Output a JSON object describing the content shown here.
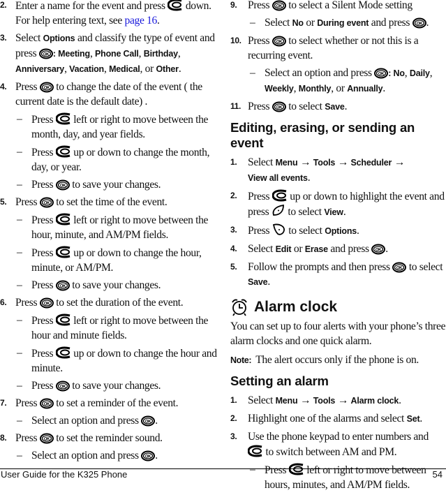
{
  "left": {
    "s2": {
      "num": "2.",
      "t1": "Enter a name for the event and press ",
      "t2": " down. For help entering text, see ",
      "link": "page 16",
      "t3": "."
    },
    "s3": {
      "num": "3.",
      "t1": "Select ",
      "ui1": "Options",
      "t2": " and classify the type of event and press ",
      "t3": ": ",
      "opts": [
        "Meeting",
        "Phone Call",
        "Birthday",
        "Anniversary",
        "Vacation",
        "Medical"
      ],
      "or": ", or ",
      "last": "Other",
      "end": "."
    },
    "s4": {
      "num": "4.",
      "t1": "Press ",
      "t2": " to change the date of the event ( the current date is the default date) .",
      "subs": [
        {
          "t1": "Press ",
          "t2": " left or right to move between the month, day, and year fields."
        },
        {
          "t1": "Press ",
          "t2": " up or down to change the month, day, or year."
        },
        {
          "t1": "Press ",
          "t2": " to save your changes."
        }
      ]
    },
    "s5": {
      "num": "5.",
      "t1": "Press ",
      "t2": " to set the time of the event.",
      "subs": [
        {
          "t1": "Press ",
          "t2": " left or right to move between the hour, minute, and AM/PM fields."
        },
        {
          "t1": "Press ",
          "t2": " up or down to change the hour, minute, or AM/PM."
        },
        {
          "t1": "Press ",
          "t2": " to save your changes."
        }
      ]
    },
    "s6": {
      "num": "6.",
      "t1": "Press ",
      "t2": " to set the duration of the event.",
      "subs": [
        {
          "t1": "Press ",
          "t2": " left or right to move between the hour and minute fields."
        },
        {
          "t1": "Press ",
          "t2": " up or down to change the hour and minute."
        },
        {
          "t1": "Press ",
          "t2": " to save your changes."
        }
      ]
    },
    "s7": {
      "num": "7.",
      "t1": "Press ",
      "t2": " to set a reminder of the event.",
      "sub": {
        "t1": "Select an option and press ",
        "t2": "."
      }
    },
    "s8": {
      "num": "8.",
      "t1": "Press ",
      "t2": " to set the reminder sound.",
      "sub": {
        "t1": "Select an option and press ",
        "t2": "."
      }
    }
  },
  "right": {
    "s9": {
      "num": "9.",
      "t1": "Press ",
      "t2": " to select a Silent Mode setting",
      "sub": {
        "t1": "Select ",
        "ui1": "No",
        "or": " or ",
        "ui2": "During event",
        "t2": " and press ",
        "t3": "."
      }
    },
    "s10": {
      "num": "10.",
      "t1": "Press ",
      "t2": " to select whether or not this is a recurring event.",
      "sub": {
        "t1": "Select an option and press ",
        "t2": ": ",
        "opts": [
          "No",
          "Daily",
          "Weekly",
          "Monthly"
        ],
        "or": ", or ",
        "last": "Annually",
        "end": "."
      }
    },
    "s11": {
      "num": "11.",
      "t1": "Press ",
      "t2": " to select ",
      "ui": "Save",
      "end": "."
    },
    "edit_heading": "Editing, erasing, or sending an event",
    "e1": {
      "num": "1.",
      "t1": "Select ",
      "path": [
        "Menu",
        "Tools",
        "Scheduler",
        "View all events"
      ],
      "arrow": " → ",
      "end": "."
    },
    "e2": {
      "num": "2.",
      "t1": "Press ",
      "t2": " up or down to highlight the event and press ",
      "t3": " to select ",
      "ui": "View",
      "end": "."
    },
    "e3": {
      "num": "3.",
      "t1": "Press ",
      "t2": " to select ",
      "ui": "Options",
      "end": "."
    },
    "e4": {
      "num": "4.",
      "t1": "Select ",
      "ui1": "Edit",
      "or": " or ",
      "ui2": "Erase",
      "t2": " and press ",
      "end": "."
    },
    "e5": {
      "num": "5.",
      "t1": "Follow the prompts and then press ",
      "t2": " to select ",
      "ui": "Save",
      "end": "."
    },
    "alarm_heading": "Alarm clock",
    "alarm_intro": "You can set up to four alerts with your phone’s three alarm clocks and one quick alarm.",
    "note_label": "Note:",
    "note_text": "The alert occurs only if the phone is on.",
    "setting_heading": "Setting an alarm",
    "a1": {
      "num": "1.",
      "t1": "Select ",
      "path": [
        "Menu",
        "Tools",
        "Alarm clock"
      ],
      "arrow": " → ",
      "end": "."
    },
    "a2": {
      "num": "2.",
      "t1": "Highlight one of the alarms and select ",
      "ui": "Set",
      "end": "."
    },
    "a3": {
      "num": "3.",
      "t1": "Use the phone keypad to enter numbers and ",
      "t2": " to switch between AM and PM.",
      "sub": {
        "t1": "Press ",
        "t2": " left or right to move between hours, minutes, and AM/PM fields."
      }
    }
  },
  "icons": {
    "nav": "navigation-key-icon",
    "ok": "ok-key-icon",
    "left_soft": "left-softkey-icon",
    "right_soft": "right-softkey-icon",
    "alarm": "alarm-clock-icon"
  },
  "footer": {
    "title": "User Guide for the K325 Phone",
    "page": "54"
  },
  "colors": {
    "link": "#1a1adc",
    "text": "#111111"
  }
}
